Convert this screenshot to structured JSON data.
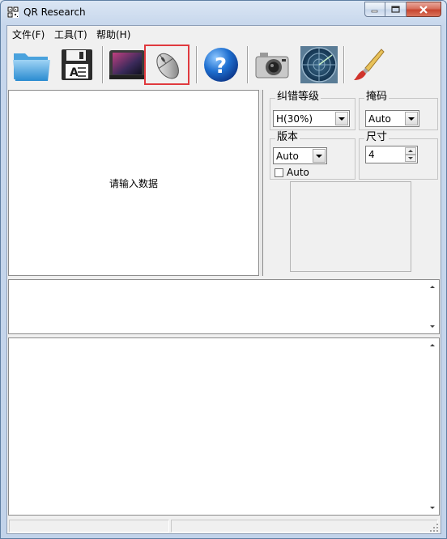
{
  "window": {
    "title": "QR Research"
  },
  "menu": {
    "items": [
      "文件(F)",
      "工具(T)",
      "帮助(H)"
    ]
  },
  "toolbar": {
    "buttons": [
      {
        "icon": "folder-icon"
      },
      {
        "icon": "save-disk-icon"
      },
      {
        "icon": "monitor-icon"
      },
      {
        "icon": "mouse-icon",
        "selected": true
      },
      {
        "icon": "help-icon"
      },
      {
        "icon": "camera-icon"
      },
      {
        "icon": "radar-icon"
      },
      {
        "icon": "paintbrush-icon"
      }
    ],
    "selected_color": "#e0393e"
  },
  "input": {
    "prompt": "请输入数据"
  },
  "settings": {
    "error_correction": {
      "label": "纠错等级",
      "value": "H(30%)"
    },
    "mask": {
      "label": "掩码",
      "value": "Auto"
    },
    "version": {
      "label": "版本",
      "value": "Auto",
      "checkbox_label": "Auto"
    },
    "size": {
      "label": "尺寸",
      "value": "4"
    }
  }
}
